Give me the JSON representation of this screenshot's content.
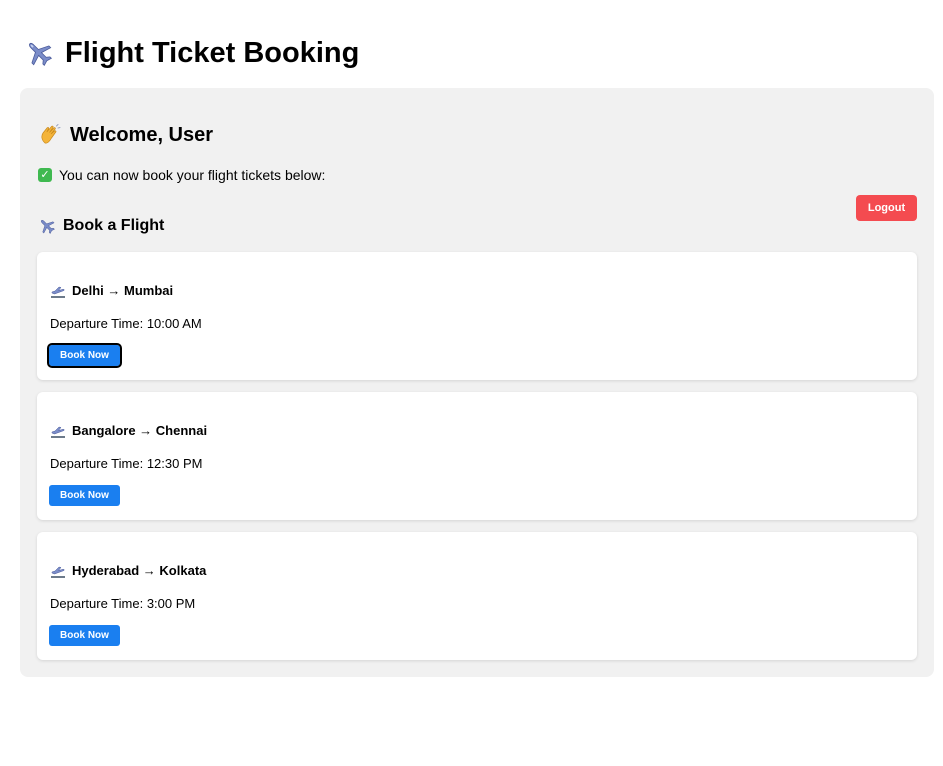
{
  "header": {
    "title": "Flight Ticket Booking",
    "icon": "airplane-icon"
  },
  "welcome": {
    "text": "Welcome, User",
    "icon": "waving-hand-icon"
  },
  "status": {
    "text": "You can now book your flight tickets below:",
    "icon": "check-mark-icon",
    "check_glyph": "✓"
  },
  "logout_label": "Logout",
  "booking": {
    "section_title": "Book a Flight",
    "icon": "airplane-icon",
    "book_label": "Book Now",
    "flights": [
      {
        "route": "Delhi → Mumbai",
        "departure": "Departure Time: 10:00 AM"
      },
      {
        "route": "Bangalore → Chennai",
        "departure": "Departure Time: 12:30 PM"
      },
      {
        "route": "Hyderabad → Kolkata",
        "departure": "Departure Time: 3:00 PM"
      }
    ]
  },
  "colors": {
    "panel_bg": "#f1f1f1",
    "primary": "#1a7ff0",
    "danger": "#f44b50",
    "success": "#3fb950"
  }
}
